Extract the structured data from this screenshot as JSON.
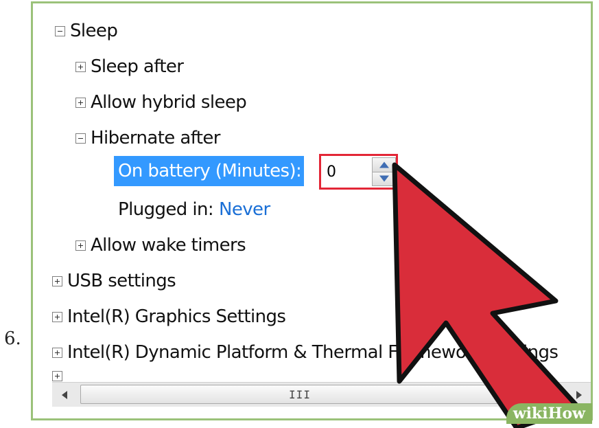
{
  "step": {
    "number": "6."
  },
  "tree": {
    "sleep": "Sleep",
    "sleep_after": "Sleep after",
    "allow_hybrid_sleep": "Allow hybrid sleep",
    "hibernate_after": "Hibernate after",
    "on_battery_label": "On battery (Minutes):",
    "on_battery_value": "0",
    "plugged_in_label": "Plugged in:",
    "plugged_in_value": "Never",
    "allow_wake_timers": "Allow wake timers",
    "usb_settings": "USB settings",
    "intel_graphics": "Intel(R) Graphics Settings",
    "intel_dptf": "Intel(R) Dynamic Platform & Thermal Framework Settings"
  },
  "scrollbar": {
    "grip": "III"
  },
  "watermark": {
    "text": "wikiHow"
  },
  "colors": {
    "highlight": "#3399ff",
    "value_link": "#1a6fd6",
    "callout_border": "#e32636",
    "cursor_fill": "#d92d3a",
    "frame_border": "#9bc27a"
  }
}
